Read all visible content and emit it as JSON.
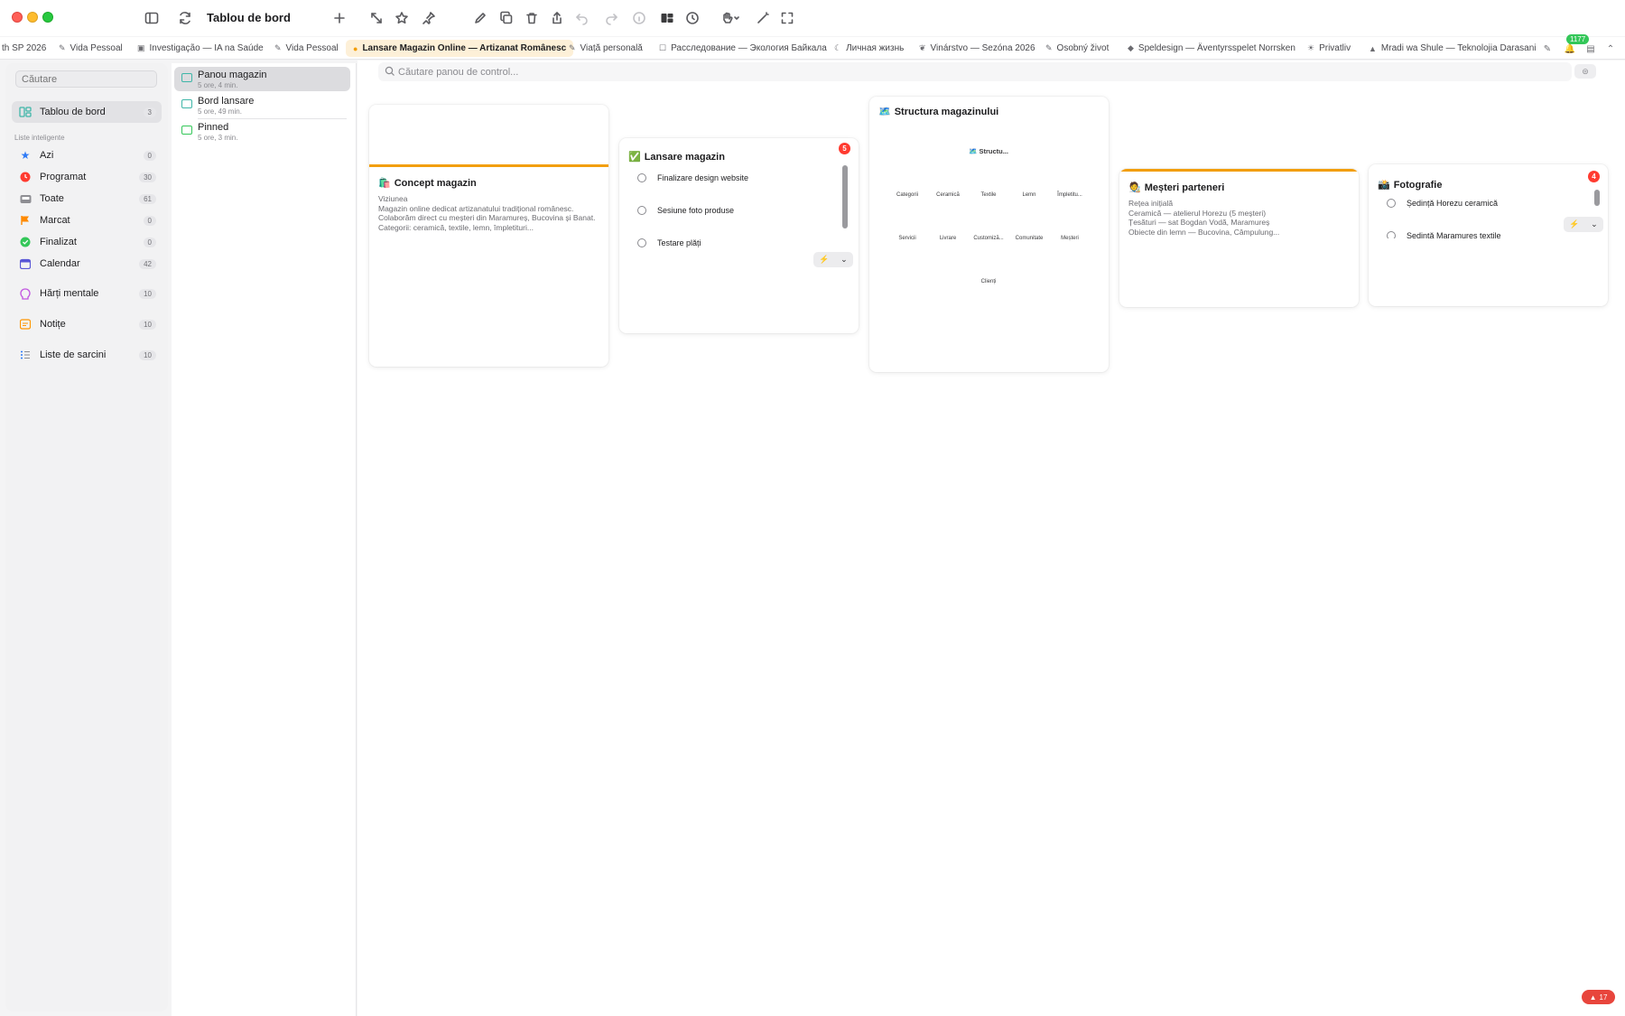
{
  "window": {
    "title": "Tablou de bord"
  },
  "tabs": [
    {
      "label": "th SP 2026",
      "icon": ""
    },
    {
      "label": "Vida Pessoal",
      "icon": "✎"
    },
    {
      "label": "Investigação — IA na Saúde",
      "icon": "▣"
    },
    {
      "label": "Vida Pessoal",
      "icon": "✎"
    },
    {
      "label": "Lansare Magazin Online — Artizanat Românesc",
      "icon": "●"
    },
    {
      "label": "Viață personală",
      "icon": "✎"
    },
    {
      "label": "Расследование — Экология Байкала",
      "icon": "☐"
    },
    {
      "label": "Личная жизнь",
      "icon": "☾"
    },
    {
      "label": "Vinárstvo — Sezóna 2026",
      "icon": "❦"
    },
    {
      "label": "Osobný život",
      "icon": "✎"
    },
    {
      "label": "Speldesign — Äventyrsspelet Norrsken",
      "icon": "◆"
    },
    {
      "label": "Privatliv",
      "icon": "☀"
    },
    {
      "label": "Mradi wa Shule — Teknolojia Darasani",
      "icon": "▲"
    }
  ],
  "notifications": {
    "count": "1177"
  },
  "sidebar": {
    "search_placeholder": "Căutare",
    "dashboard": {
      "label": "Tablou de bord",
      "count": "3"
    },
    "section_label": "Liste inteligente",
    "items": [
      {
        "label": "Azi",
        "count": "0",
        "icon": "star-icon",
        "color": "#2f7bf6"
      },
      {
        "label": "Programat",
        "count": "30",
        "icon": "clock-icon",
        "color": "#ff3b30"
      },
      {
        "label": "Toate",
        "count": "61",
        "icon": "tray-icon",
        "color": "#8e8e93"
      },
      {
        "label": "Marcat",
        "count": "0",
        "icon": "flag-icon",
        "color": "#ff8a00"
      },
      {
        "label": "Finalizat",
        "count": "0",
        "icon": "check-circle-icon",
        "color": "#34c759"
      },
      {
        "label": "Calendar",
        "count": "42",
        "icon": "calendar-icon",
        "color": "#5856d6"
      }
    ],
    "groups": [
      {
        "label": "Hărți mentale",
        "count": "10",
        "icon": "mindmap-icon",
        "color": "#c155e0"
      },
      {
        "label": "Notițe",
        "count": "10",
        "icon": "note-icon",
        "color": "#ff9500"
      },
      {
        "label": "Liste de sarcini",
        "count": "10",
        "icon": "checklist-icon",
        "color": "#2f7bf6"
      }
    ]
  },
  "documents": [
    {
      "name": "Panou magazin",
      "time": "5 ore, 4 min."
    },
    {
      "name": "Bord lansare",
      "time": "5 ore, 49 min."
    },
    {
      "name": "Pinned",
      "time": "5 ore, 3 min."
    }
  ],
  "canvas": {
    "search_placeholder": "Căutare panou de control...",
    "cards": {
      "concept": {
        "emoji": "🛍️",
        "title": "Concept magazin",
        "lines": [
          "Viziunea",
          "Magazin online dedicat artizanatului tradițional românesc.",
          "Colaborăm direct cu meșteri din Maramureș, Bucovina și Banat.",
          "Categorii: ceramică, textile, lemn, împletituri..."
        ]
      },
      "launch": {
        "emoji": "✅",
        "title": "Lansare magazin",
        "badge": "5",
        "tasks": [
          "Finalizare design website",
          "Sesiune foto produse",
          "Testare plăți"
        ]
      },
      "structure": {
        "emoji": "🗺️",
        "title": "Structura magazinului",
        "root": "🗺️ Structu...",
        "nodes_row1": [
          "Categorii",
          "Ceramică",
          "Textile",
          "Lemn",
          "Împletitu..."
        ],
        "nodes_row2": [
          "Servicii",
          "Livrare",
          "Customiză...",
          "Comunitate",
          "Meșteri"
        ],
        "nodes_row3": [
          "Clienți"
        ]
      },
      "artisans": {
        "emoji": "🧑‍🎨",
        "title": "Meșteri parteneri",
        "lines": [
          "Rețea inițială",
          "Ceramică — atelierul Horezu (5 meșteri)",
          "Țesături — sat Bogdan Vodă, Maramureș",
          "Obiecte din lemn — Bucovina, Câmpulung..."
        ]
      },
      "photo": {
        "emoji": "📸",
        "title": "Fotografie",
        "badge": "4",
        "tasks": [
          "Ședință Horezu ceramică",
          "Ședință Maramureș textile"
        ]
      }
    }
  },
  "alerts": {
    "count": "17"
  }
}
